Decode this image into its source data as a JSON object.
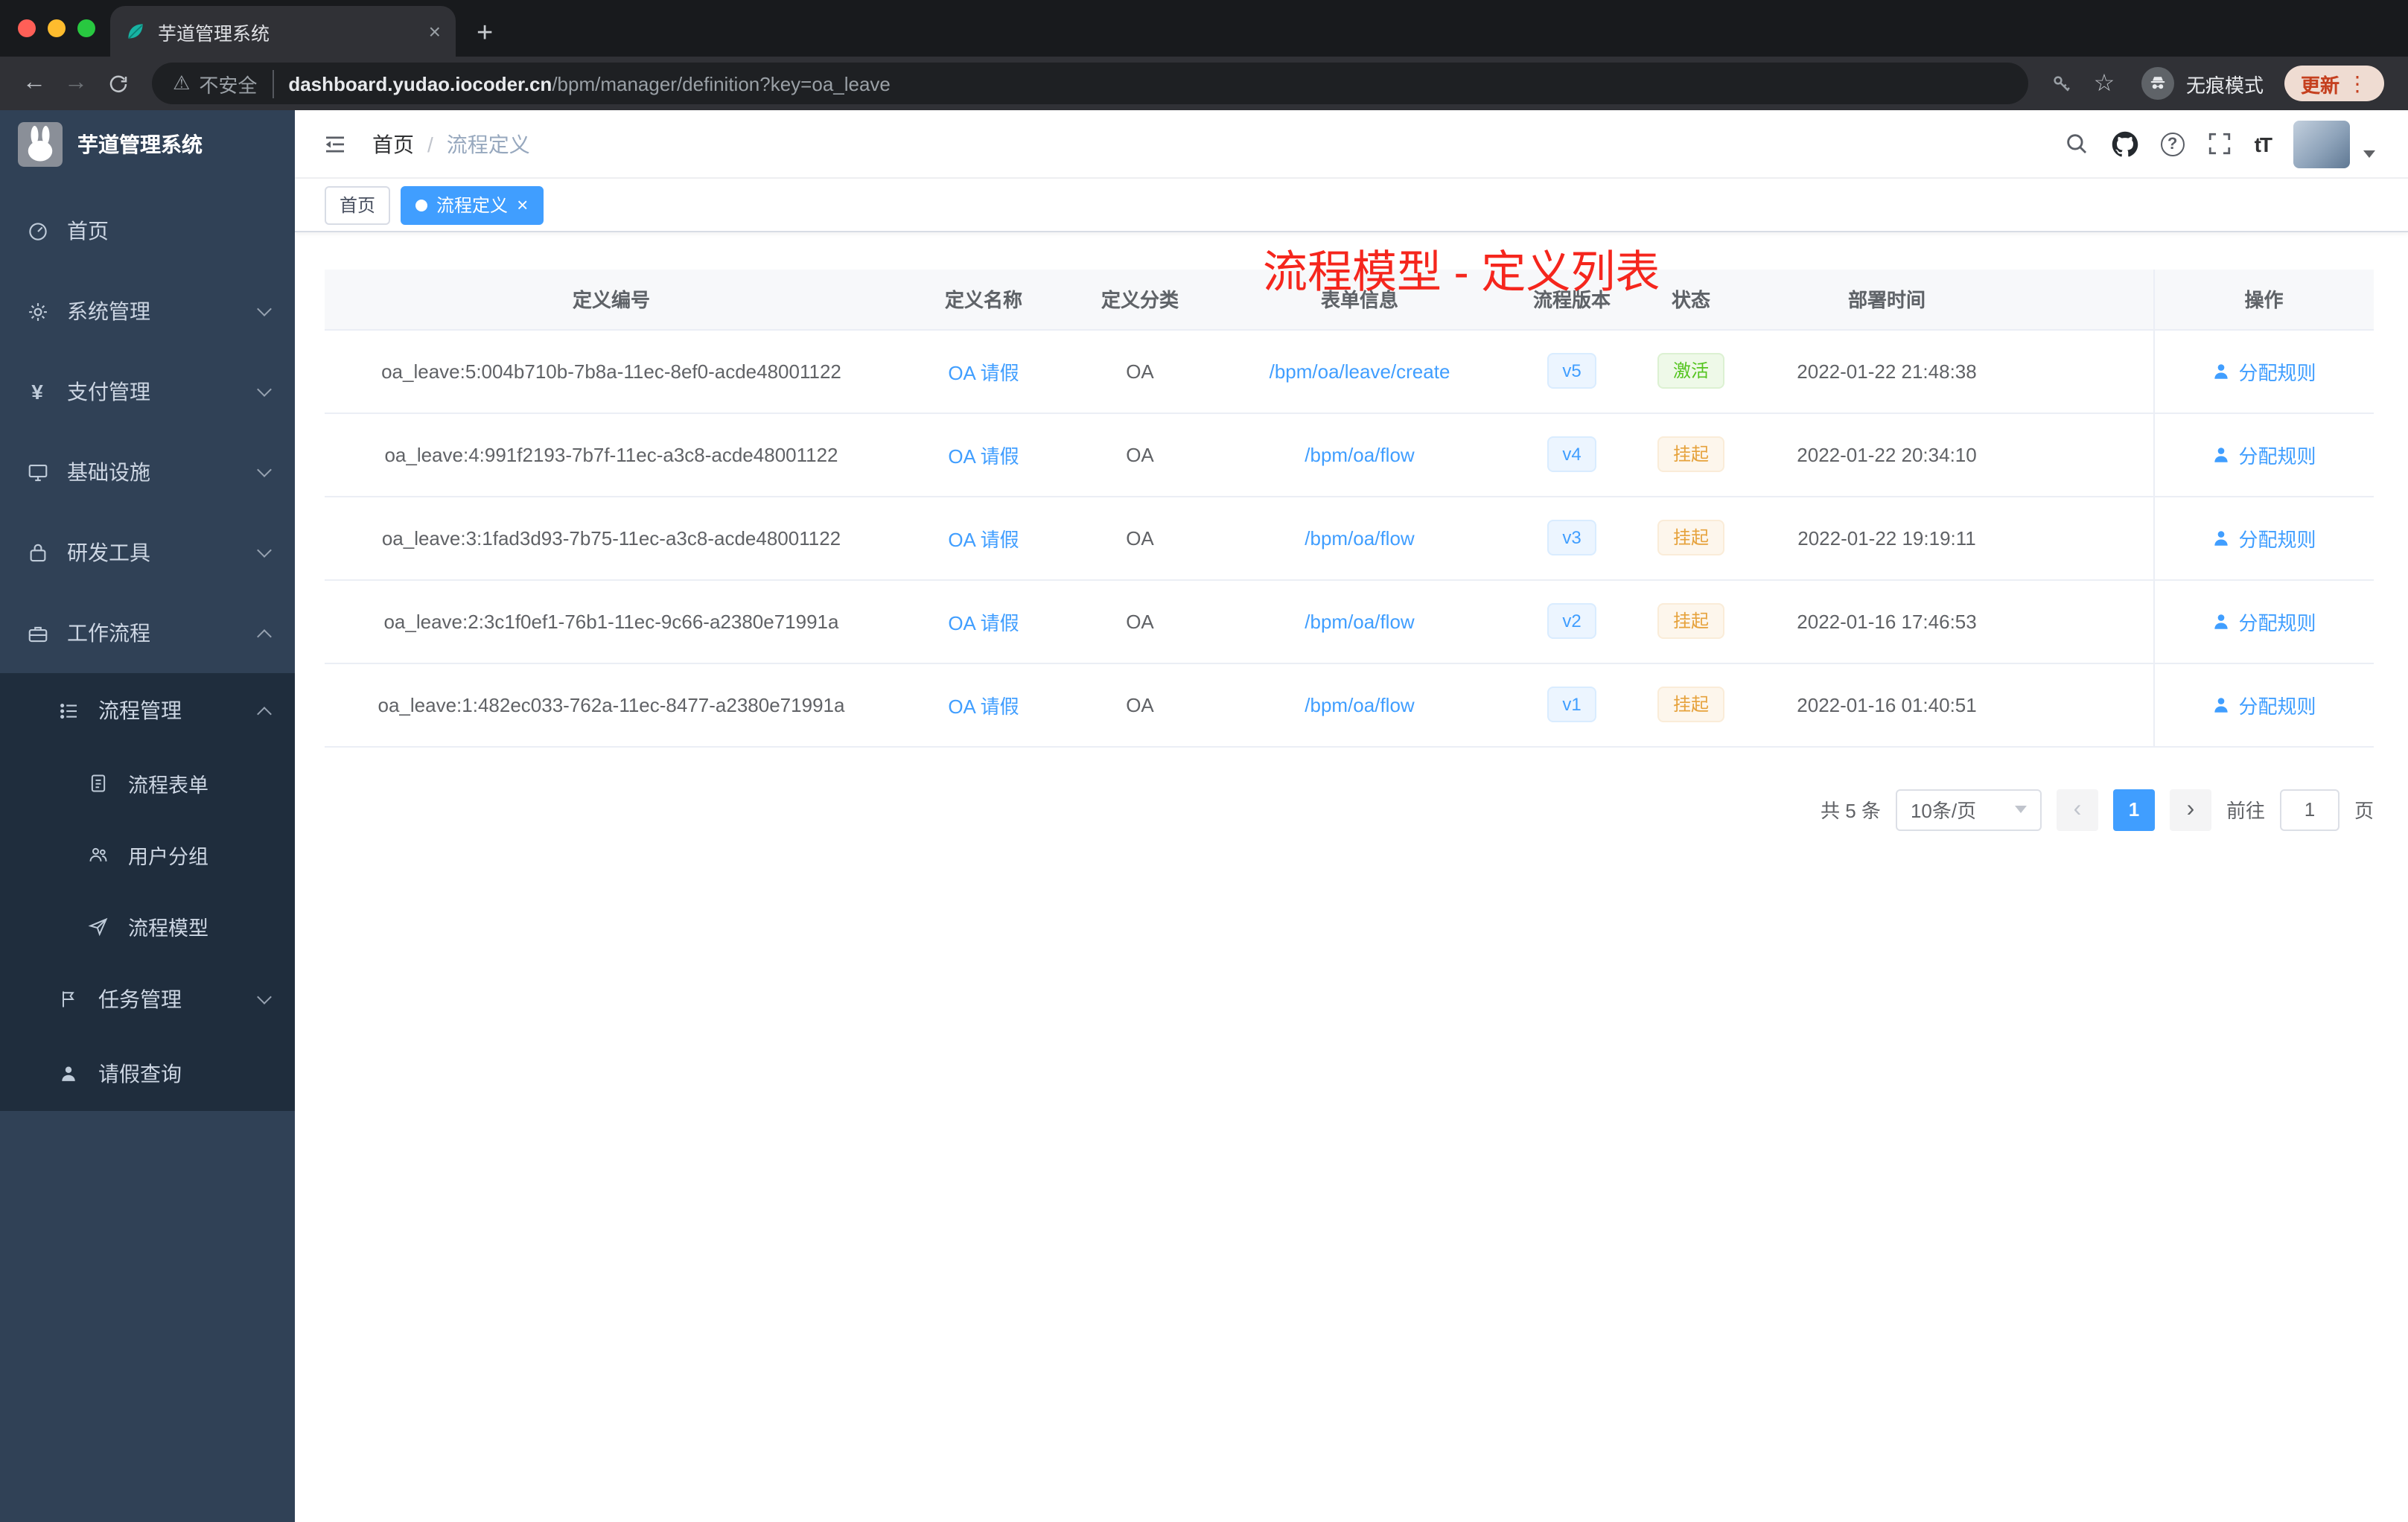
{
  "browser": {
    "tab": {
      "title": "芋道管理系统"
    },
    "address": {
      "security_label": "不安全",
      "domain": "dashboard.yudao.iocoder.cn",
      "path": "/bpm/manager/definition?key=oa_leave"
    },
    "incognito_label": "无痕模式",
    "update_label": "更新"
  },
  "icons": {
    "close": "×",
    "plus": "+",
    "back": "←",
    "forward": "→",
    "warning": "⚠",
    "star": "☆",
    "more_vertical": "⋮",
    "help": "?",
    "text_size": "tT",
    "yen": "¥",
    "breadcrumb_separator": "/",
    "prev": "‹",
    "next": "›"
  },
  "colors": {
    "accent": "#409eff",
    "success": "#54c41f",
    "warning": "#e6a23c",
    "annotation": "#f5261d",
    "sidebar_bg": "#304156",
    "submenu_bg": "#1f2d3d"
  },
  "sidebar": {
    "logo_title": "芋道管理系统",
    "items": [
      {
        "label": "首页"
      },
      {
        "label": "系统管理"
      },
      {
        "label": "支付管理"
      },
      {
        "label": "基础设施"
      },
      {
        "label": "研发工具"
      },
      {
        "label": "工作流程"
      },
      {
        "label": "流程管理"
      },
      {
        "label": "流程表单"
      },
      {
        "label": "用户分组"
      },
      {
        "label": "流程模型"
      },
      {
        "label": "任务管理"
      },
      {
        "label": "请假查询"
      }
    ]
  },
  "header": {
    "breadcrumb": {
      "home": "首页",
      "current": "流程定义"
    },
    "annotation": "流程模型 - 定义列表"
  },
  "tags_view": {
    "home": "首页",
    "active": "流程定义"
  },
  "table": {
    "columns": {
      "id": "定义编号",
      "name": "定义名称",
      "category": "定义分类",
      "form": "表单信息",
      "version": "流程版本",
      "status": "状态",
      "deploy_time": "部署时间",
      "actions": "操作"
    },
    "rows": [
      {
        "id": "oa_leave:5:004b710b-7b8a-11ec-8ef0-acde48001122",
        "name": "OA 请假",
        "category": "OA",
        "form": "/bpm/oa/leave/create",
        "version": "v5",
        "status": {
          "label": "激活",
          "type": "success"
        },
        "deploy_time": "2022-01-22 21:48:38",
        "action": "分配规则"
      },
      {
        "id": "oa_leave:4:991f2193-7b7f-11ec-a3c8-acde48001122",
        "name": "OA 请假",
        "category": "OA",
        "form": "/bpm/oa/flow",
        "version": "v4",
        "status": {
          "label": "挂起",
          "type": "warning"
        },
        "deploy_time": "2022-01-22 20:34:10",
        "action": "分配规则"
      },
      {
        "id": "oa_leave:3:1fad3d93-7b75-11ec-a3c8-acde48001122",
        "name": "OA 请假",
        "category": "OA",
        "form": "/bpm/oa/flow",
        "version": "v3",
        "status": {
          "label": "挂起",
          "type": "warning"
        },
        "deploy_time": "2022-01-22 19:19:11",
        "action": "分配规则"
      },
      {
        "id": "oa_leave:2:3c1f0ef1-76b1-11ec-9c66-a2380e71991a",
        "name": "OA 请假",
        "category": "OA",
        "form": "/bpm/oa/flow",
        "version": "v2",
        "status": {
          "label": "挂起",
          "type": "warning"
        },
        "deploy_time": "2022-01-16 17:46:53",
        "action": "分配规则"
      },
      {
        "id": "oa_leave:1:482ec033-762a-11ec-8477-a2380e71991a",
        "name": "OA 请假",
        "category": "OA",
        "form": "/bpm/oa/flow",
        "version": "v1",
        "status": {
          "label": "挂起",
          "type": "warning"
        },
        "deploy_time": "2022-01-16 01:40:51",
        "action": "分配规则"
      }
    ]
  },
  "pagination": {
    "total": "共 5 条",
    "page_size": "10条/页",
    "page": "1",
    "goto_label": "前往",
    "goto_value": "1",
    "goto_unit": "页"
  }
}
